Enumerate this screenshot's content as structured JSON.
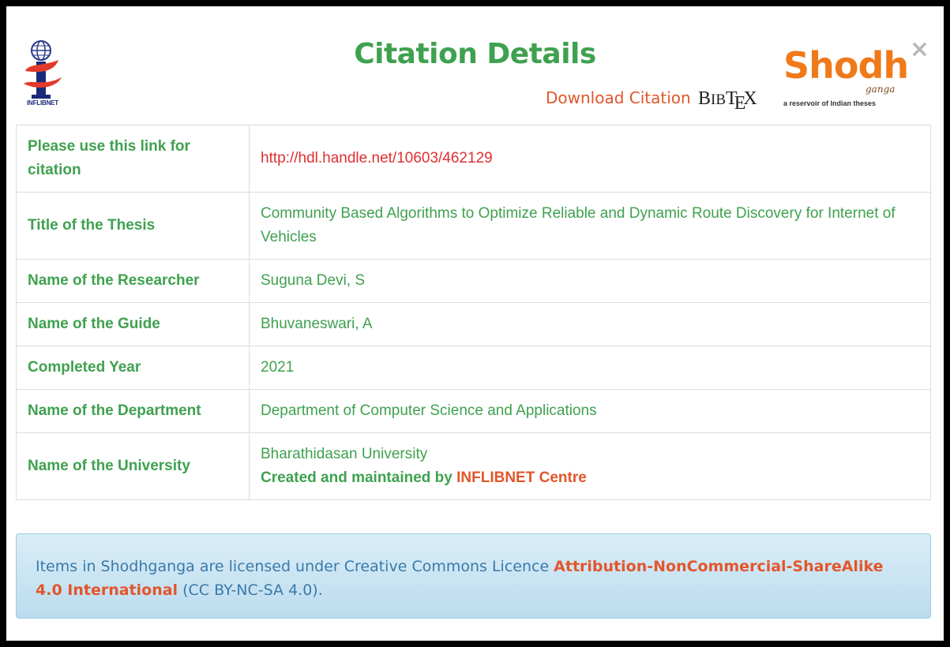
{
  "modal": {
    "title": "Citation Details",
    "close_glyph": "×",
    "logos": {
      "inflibnet": {
        "text": "INFLIBNET",
        "icon": "inflibnet-logo-icon"
      },
      "shodhganga": {
        "word": "Shodh",
        "sub": "ganga",
        "tagline": "a reservoir of Indian theses",
        "icon": "shodhganga-logo-icon"
      }
    },
    "download_citation_label": "Download Citation",
    "bibtex": {
      "part1": "B",
      "part2": "IB",
      "part3": "T",
      "part4": "E",
      "part5": "X"
    }
  },
  "details": [
    {
      "label": "Please use this link for citation",
      "value": "http://hdl.handle.net/10603/462129"
    },
    {
      "label": "Title of the Thesis",
      "value": "Community Based Algorithms to Optimize Reliable and Dynamic Route Discovery for Internet of Vehicles"
    },
    {
      "label": "Name of the Researcher",
      "value": "Suguna Devi, S"
    },
    {
      "label": "Name of the Guide",
      "value": "Bhuvaneswari, A"
    },
    {
      "label": "Completed Year",
      "value": "2021"
    },
    {
      "label": "Name of the Department",
      "value": "Department of Computer Science and Applications"
    },
    {
      "label": "Name of the University",
      "value": "Bharathidasan University"
    }
  ],
  "credit": {
    "prefix": "Created and maintained by ",
    "org": "INFLIBNET Centre"
  },
  "license": {
    "prefix": "Items in Shodhganga are licensed under Creative Commons Licence ",
    "link": "Attribution-NonCommercial-ShareAlike 4.0 International",
    "suffix": " (CC BY-NC-SA 4.0)."
  },
  "colors": {
    "accent_green": "#3fa14f",
    "accent_orange": "#e2562b",
    "link_red": "#e03030",
    "info_blue": "#3a7aa8"
  }
}
